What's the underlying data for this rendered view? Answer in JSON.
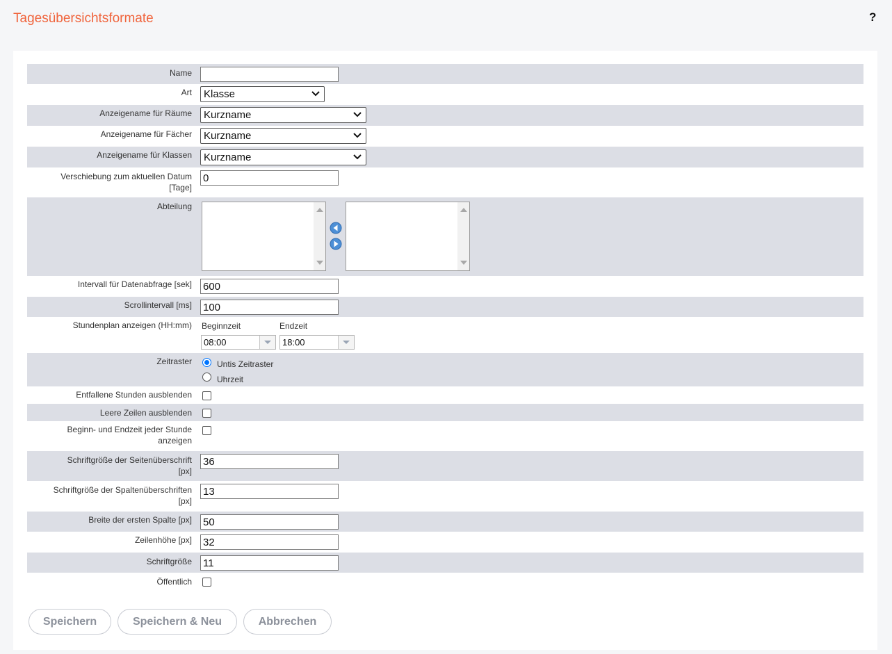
{
  "page": {
    "title": "Tagesübersichtsformate",
    "help_label": "?"
  },
  "form": {
    "name": {
      "label": "Name",
      "value": ""
    },
    "art": {
      "label": "Art",
      "value": "Klasse"
    },
    "raeume": {
      "label": "Anzeigename für Räume",
      "value": "Kurzname"
    },
    "faecher": {
      "label": "Anzeigename für Fächer",
      "value": "Kurzname"
    },
    "klassen": {
      "label": "Anzeigename für Klassen",
      "value": "Kurzname"
    },
    "verschiebung": {
      "label_line1": "Verschiebung zum aktuellen Datum",
      "label_line2": "[Tage]",
      "value": "0"
    },
    "abteilung": {
      "label": "Abteilung",
      "left_icon": "arrow-left-circle-icon",
      "right_icon": "arrow-right-circle-icon"
    },
    "intervall": {
      "label": "Intervall für Datenabfrage [sek]",
      "value": "600"
    },
    "scroll": {
      "label": "Scrollintervall [ms]",
      "value": "100"
    },
    "stundenplan": {
      "label": "Stundenplan anzeigen (HH:mm)",
      "begin_label": "Beginnzeit",
      "begin_value": "08:00",
      "end_label": "Endzeit",
      "end_value": "18:00"
    },
    "zeitraster": {
      "label": "Zeitraster",
      "options": [
        {
          "label": "Untis Zeitraster",
          "checked": true
        },
        {
          "label": "Uhrzeit",
          "checked": false
        }
      ]
    },
    "entfallene": {
      "label": "Entfallene Stunden ausblenden",
      "checked": false
    },
    "leere": {
      "label": "Leere Zeilen ausblenden",
      "checked": false
    },
    "beginn_endzeit": {
      "label_line1": "Beginn- und Endzeit jeder Stunde",
      "label_line2": "anzeigen",
      "checked": false
    },
    "schrift_seite": {
      "label_line1": "Schriftgröße der Seitenüberschrift",
      "label_line2": "[px]",
      "value": "36"
    },
    "schrift_spalte": {
      "label_line1": "Schriftgröße der Spaltenüberschriften",
      "label_line2": "[px]",
      "value": "13"
    },
    "breite": {
      "label": "Breite der ersten Spalte [px]",
      "value": "50"
    },
    "zeilenhoehe": {
      "label": "Zeilenhöhe [px]",
      "value": "32"
    },
    "schriftgroesse": {
      "label": "Schriftgröße",
      "value": "11"
    },
    "oeffentlich": {
      "label": "Öffentlich",
      "checked": false
    }
  },
  "buttons": {
    "save": "Speichern",
    "save_new": "Speichern & Neu",
    "cancel": "Abbrechen"
  },
  "colors": {
    "accent": "#f0643c",
    "row_shade": "#dcdee5",
    "radio_blue": "#0075ff"
  }
}
